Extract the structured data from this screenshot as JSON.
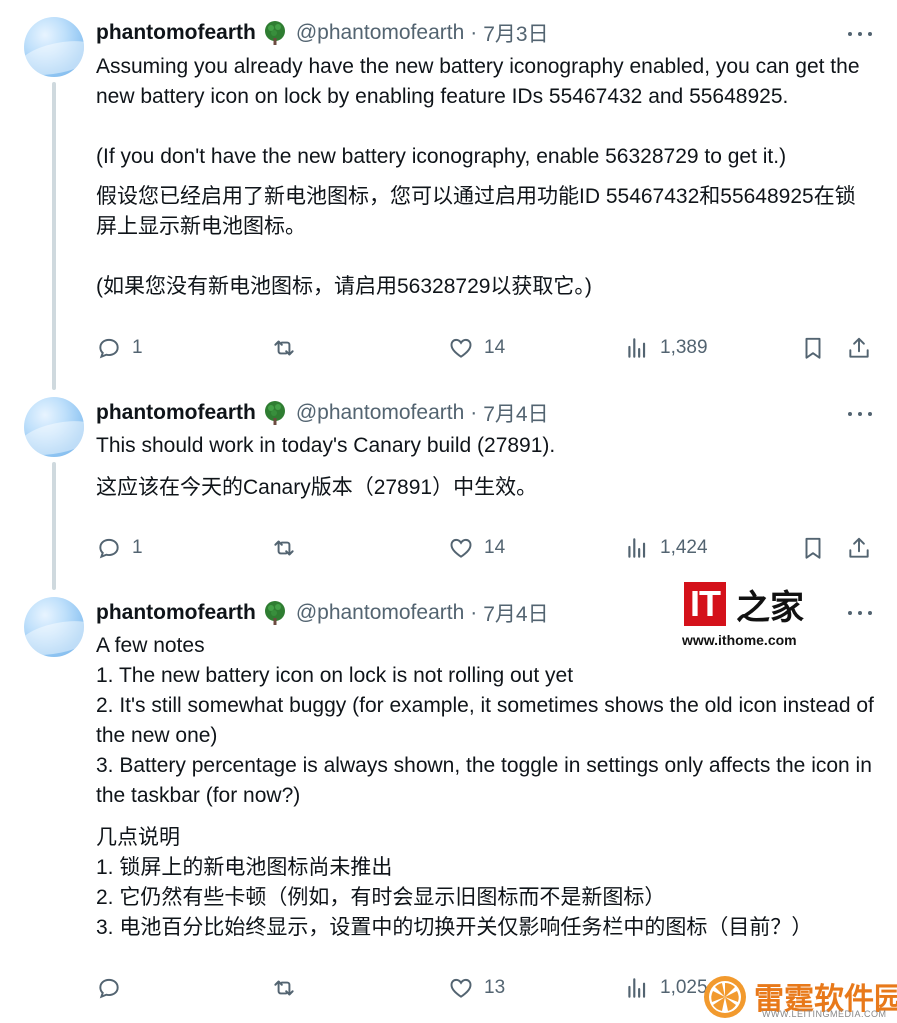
{
  "tweets": [
    {
      "name": "phantomofearth",
      "handle": "@phantomofearth",
      "separator": "·",
      "date": "7月3日",
      "paragraphs": [
        "Assuming you already have the new battery iconography enabled, you can get the new battery icon on lock by enabling feature IDs 55467432 and 55648925.",
        "(If you don't have the new battery iconography, enable 56328729 to get it.)",
        "假设您已经启用了新电池图标，您可以通过启用功能ID 55467432和55648925在锁屏上显示新电池图标。",
        "(如果您没有新电池图标，请启用56328729以获取它。)"
      ],
      "replies": "1",
      "likes": "14",
      "views": "1,389"
    },
    {
      "name": "phantomofearth",
      "handle": "@phantomofearth",
      "separator": "·",
      "date": "7月4日",
      "paragraphs": [
        "This should work in today's Canary build (27891).",
        "这应该在今天的Canary版本（27891）中生效。"
      ],
      "replies": "1",
      "likes": "14",
      "views": "1,424"
    },
    {
      "name": "phantomofearth",
      "handle": "@phantomofearth",
      "separator": "·",
      "date": "7月4日",
      "paragraphs": [
        "A few notes\n1. The new battery icon on lock is not rolling out yet\n2. It's still somewhat buggy (for example, it sometimes shows the old icon instead of the new one)\n3. Battery percentage is always shown, the toggle in settings only affects the icon in the taskbar (for now?)",
        "几点说明\n1. 锁屏上的新电池图标尚未推出\n2. 它仍然有些卡顿（例如，有时会显示旧图标而不是新图标）\n3. 电池百分比始终显示，设置中的切换开关仅影响任务栏中的图标（目前？）"
      ],
      "replies": "",
      "likes": "13",
      "views": "1,025"
    }
  ],
  "watermarks": {
    "ithome_logo": "IT之家",
    "ithome_url": "www.ithome.com",
    "leiting_name": "雷霆软件园",
    "leiting_url": "WWW.LEITINGMEDIA.COM"
  },
  "colors": {
    "text": "#0f1419",
    "secondary": "#536471",
    "thread_line": "#cfd9de",
    "ithome_red": "#d4111a",
    "leiting_orange": "#e8791a"
  },
  "icons": [
    "reply-icon",
    "retweet-icon",
    "like-icon",
    "views-icon",
    "bookmark-icon",
    "share-icon",
    "more-icon",
    "tree-badge-icon"
  ]
}
